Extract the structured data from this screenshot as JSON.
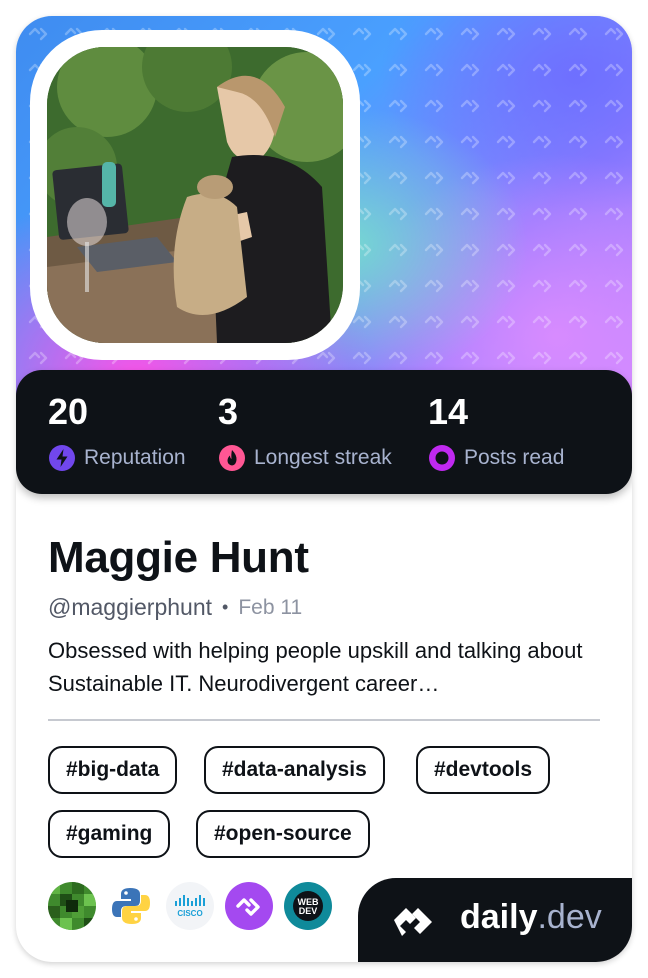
{
  "profile": {
    "name": "Maggie Hunt",
    "handle": "@maggierphunt",
    "separator": "•",
    "date": "Feb 11",
    "bio": "Obsessed with helping people upskill and talking about Sustainable IT. Neurodivergent career…"
  },
  "stats": [
    {
      "value": "20",
      "label": "Reputation",
      "icon": "bolt-icon",
      "color": "#7147ed"
    },
    {
      "value": "3",
      "label": "Longest streak",
      "icon": "flame-icon",
      "color": "#ff5794"
    },
    {
      "value": "14",
      "label": "Posts read",
      "icon": "eye-ring-icon",
      "color": "#c029f0"
    }
  ],
  "tags": [
    "#big-data",
    "#data-analysis",
    "#devtools",
    "#gaming",
    "#open-source"
  ],
  "stack_icons": [
    "minecraft-icon",
    "python-icon",
    "cisco-icon",
    "daily-dev-icon",
    "webdev-icon"
  ],
  "stack_text": {
    "cisco": "CISCO",
    "webdev_top": "WEB",
    "webdev_bottom": "DEV"
  },
  "brand": {
    "name": "daily",
    "suffix": ".dev"
  },
  "colors": {
    "dark": "#0e1217",
    "muted": "#a8b3cf",
    "accent": "#7147ed"
  }
}
